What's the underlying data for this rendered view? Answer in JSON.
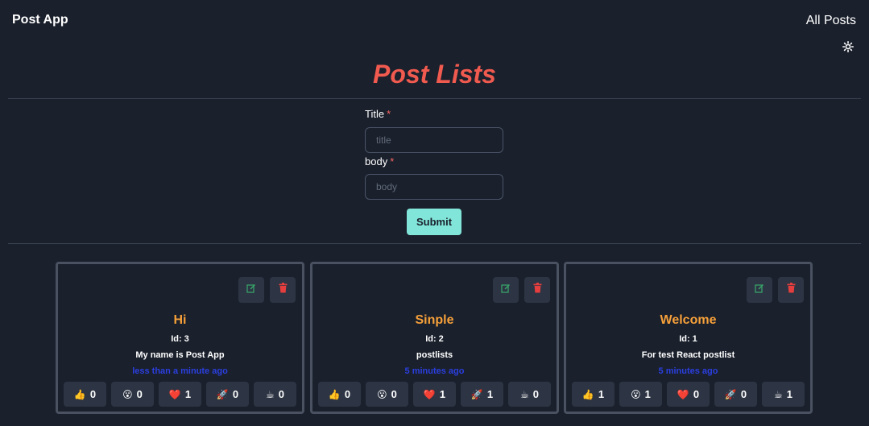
{
  "header": {
    "brand": "Post App",
    "nav_link": "All Posts",
    "theme_icon": "sun-icon"
  },
  "page_title": "Post Lists",
  "form": {
    "title_label": "Title",
    "title_placeholder": "title",
    "body_label": "body",
    "body_placeholder": "body",
    "required_mark": "*",
    "submit_label": "Submit"
  },
  "colors": {
    "background": "#1a202c",
    "title_accent": "#f05a4f",
    "post_title": "#f6a03a",
    "timestamp": "#2b3fe0",
    "submit_button": "#81e6d9",
    "edit_icon": "#38a169",
    "delete_icon": "#e53e3e"
  },
  "posts": [
    {
      "title": "Hi",
      "id_text": "Id: 3",
      "body": "My name is Post App",
      "time": "less than a minute ago",
      "reactions": [
        {
          "emoji": "👍",
          "icon": "thumbs-up-icon",
          "count": "0"
        },
        {
          "emoji": "😮",
          "icon": "wow-icon",
          "count": "0"
        },
        {
          "emoji": "❤️",
          "icon": "heart-icon",
          "count": "1"
        },
        {
          "emoji": "🚀",
          "icon": "rocket-icon",
          "count": "0"
        },
        {
          "emoji": "☕",
          "icon": "coffee-icon",
          "count": "0"
        }
      ]
    },
    {
      "title": "Sinple",
      "id_text": "Id: 2",
      "body": "postlists",
      "time": "5 minutes ago",
      "reactions": [
        {
          "emoji": "👍",
          "icon": "thumbs-up-icon",
          "count": "0"
        },
        {
          "emoji": "😮",
          "icon": "wow-icon",
          "count": "0"
        },
        {
          "emoji": "❤️",
          "icon": "heart-icon",
          "count": "1"
        },
        {
          "emoji": "🚀",
          "icon": "rocket-icon",
          "count": "1"
        },
        {
          "emoji": "☕",
          "icon": "coffee-icon",
          "count": "0"
        }
      ]
    },
    {
      "title": "Welcome",
      "id_text": "Id: 1",
      "body": "For test React postlist",
      "time": "5 minutes ago",
      "reactions": [
        {
          "emoji": "👍",
          "icon": "thumbs-up-icon",
          "count": "1"
        },
        {
          "emoji": "😮",
          "icon": "wow-icon",
          "count": "1"
        },
        {
          "emoji": "❤️",
          "icon": "heart-icon",
          "count": "0"
        },
        {
          "emoji": "🚀",
          "icon": "rocket-icon",
          "count": "0"
        },
        {
          "emoji": "☕",
          "icon": "coffee-icon",
          "count": "1"
        }
      ]
    }
  ]
}
